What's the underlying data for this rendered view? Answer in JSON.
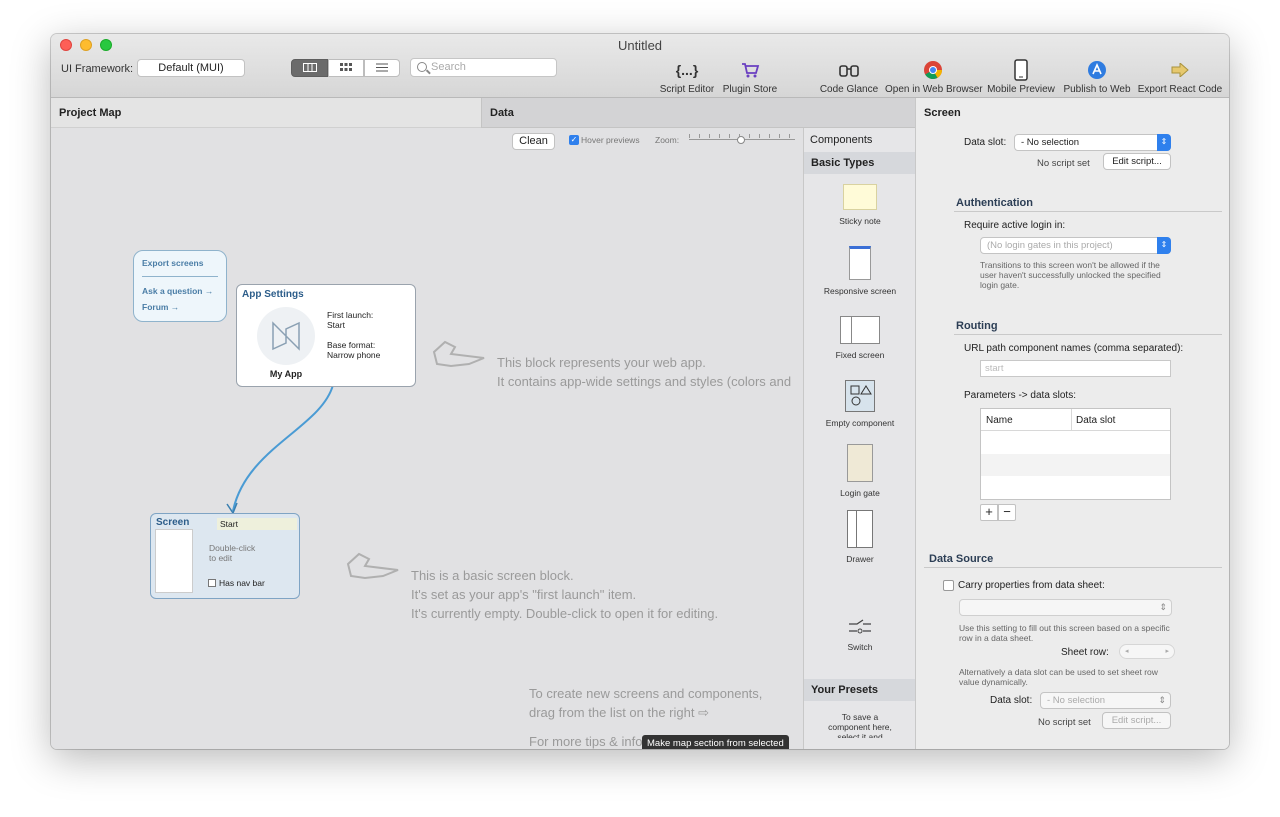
{
  "window": {
    "title": "Untitled"
  },
  "toolbar": {
    "framework_label": "UI Framework:",
    "framework_value": "Default (MUI)",
    "search_placeholder": "Search",
    "tools": [
      {
        "icon": "{...}",
        "label": "Script Editor"
      },
      {
        "icon": "cart",
        "label": "Plugin Store"
      },
      {
        "icon": "binoculars",
        "label": "Code Glance"
      },
      {
        "icon": "chrome",
        "label": "Open in Web Browser"
      },
      {
        "icon": "phone",
        "label": "Mobile Preview"
      },
      {
        "icon": "publish",
        "label": "Publish to Web"
      },
      {
        "icon": "export-arrow",
        "label": "Export React Code"
      }
    ]
  },
  "tabs": {
    "project_map": "Project Map",
    "data": "Data",
    "screen": "Screen"
  },
  "map_toolbar": {
    "clean": "Clean",
    "hover_previews": "Hover previews",
    "zoom": "Zoom:"
  },
  "help_node": {
    "export": "Export screens",
    "ask": "Ask a question →",
    "forum": "Forum →"
  },
  "app_node": {
    "title": "App Settings",
    "first_launch_label": "First launch:",
    "first_launch_value": "Start",
    "base_format_label": "Base format:",
    "base_format_value": "Narrow phone",
    "name": "My App"
  },
  "screen_node": {
    "title": "Screen",
    "name": "Start",
    "hint_line1": "Double-click",
    "hint_line2": "to edit",
    "navbar": "Has nav bar"
  },
  "hints": {
    "app_line1": "This block represents your web app.",
    "app_line2": "It contains app-wide settings and styles (colors and",
    "screen_line1": "This is a basic screen block.",
    "screen_line2": "It's set as your app's \"first launch\" item.",
    "screen_line3": "It's currently empty. Double-click to open it for editing.",
    "create_line1": "To create new screens and components,",
    "create_line2": "drag from the list on the right  ⇨",
    "tips": "For more tips & info",
    "tooltip": "Make map section from selected"
  },
  "components": {
    "header": "Components",
    "basic_types": "Basic Types",
    "items": [
      "Sticky note",
      "Responsive screen",
      "Fixed screen",
      "Empty component",
      "Login gate",
      "Drawer",
      "Switch"
    ],
    "presets_header": "Your Presets",
    "presets_hint": "To save a component here, select it and"
  },
  "screen_panel": {
    "data_slot_label": "Data slot:",
    "data_slot_value": "- No selection",
    "no_script": "No script set",
    "edit_script": "Edit script...",
    "auth_header": "Authentication",
    "login_label": "Require active login in:",
    "login_value": "(No login gates in this project)",
    "login_note": "Transitions to this screen won't be allowed if the user haven't successfully unlocked the specified login gate.",
    "routing_header": "Routing",
    "url_label": "URL path component names (comma separated):",
    "url_placeholder": "start",
    "params_label": "Parameters -> data slots:",
    "col_name": "Name",
    "col_slot": "Data slot",
    "plus": "+",
    "minus": "−",
    "ds_header": "Data Source",
    "carry_label": "Carry properties from data sheet:",
    "carry_note": "Use this setting to fill out this screen based on a specific row in a data sheet.",
    "sheet_row": "Sheet row:",
    "alt_note": "Alternatively a data slot can be used to set sheet row value dynamically.",
    "ds_slot_label": "Data slot:",
    "ds_slot_value": "- No selection",
    "ds_no_script": "No script set",
    "ds_edit_script": "Edit script..."
  }
}
